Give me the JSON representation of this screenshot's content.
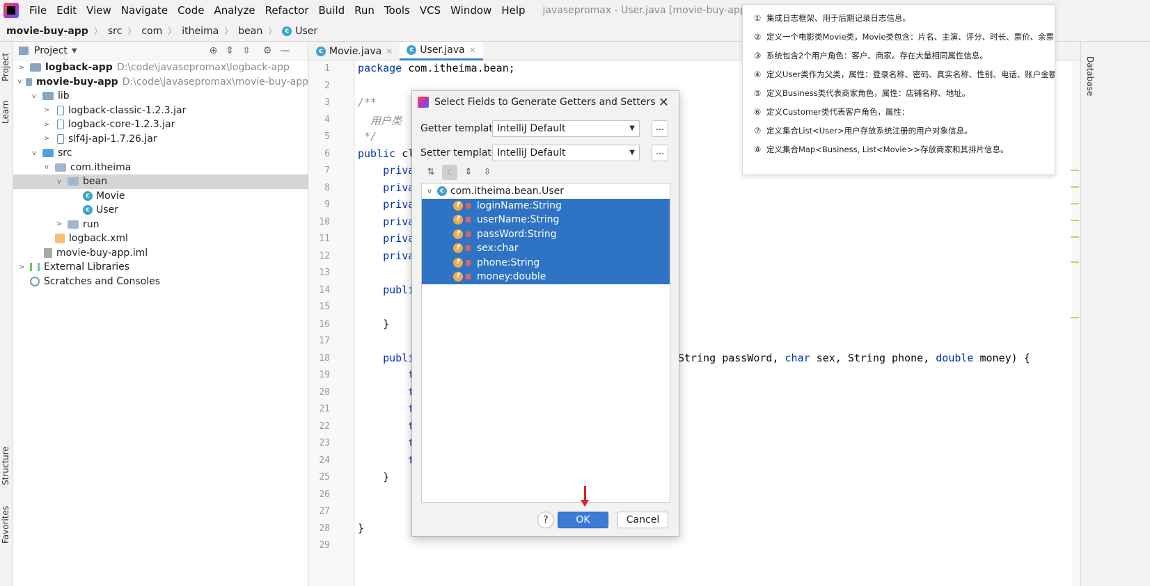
{
  "menubar": {
    "items": [
      "File",
      "Edit",
      "View",
      "Navigate",
      "Code",
      "Analyze",
      "Refactor",
      "Build",
      "Run",
      "Tools",
      "VCS",
      "Window",
      "Help"
    ],
    "window_title": "javasepromax - User.java [movie-buy-app]"
  },
  "navbar": {
    "crumbs": [
      "movie-buy-app",
      "src",
      "com",
      "itheima",
      "bean",
      "User"
    ]
  },
  "left_strip": {
    "project": "Project",
    "learn": "Learn",
    "structure": "Structure",
    "favorites": "Favorites"
  },
  "right_strip": {
    "database": "Database"
  },
  "project_panel": {
    "title": "Project",
    "tree": [
      {
        "label": "logback-app",
        "path": "D:\\code\\javasepromax\\logback-app",
        "bold": true
      },
      {
        "label": "movie-buy-app",
        "path": "D:\\code\\javasepromax\\movie-buy-app",
        "bold": true
      },
      {
        "label": "lib"
      },
      {
        "label": "logback-classic-1.2.3.jar"
      },
      {
        "label": "logback-core-1.2.3.jar"
      },
      {
        "label": "slf4j-api-1.7.26.jar"
      },
      {
        "label": "src"
      },
      {
        "label": "com.itheima"
      },
      {
        "label": "bean"
      },
      {
        "label": "Movie"
      },
      {
        "label": "User"
      },
      {
        "label": "run"
      },
      {
        "label": "logback.xml"
      },
      {
        "label": "movie-buy-app.iml"
      },
      {
        "label": "External Libraries"
      },
      {
        "label": "Scratches and Consoles"
      }
    ]
  },
  "editor": {
    "tabs": [
      "Movie.java",
      "User.java"
    ],
    "line_numbers": [
      "1",
      "2",
      "3",
      "4",
      "5",
      "6",
      "7",
      "8",
      "9",
      "10",
      "11",
      "12",
      "13",
      "14",
      "15",
      "16",
      "17",
      "18",
      "19",
      "20",
      "21",
      "22",
      "23",
      "24",
      "25",
      "26",
      "27",
      "28",
      "29"
    ],
    "code": {
      "l1_kw": "package",
      "l1_rest": " com.itheima.bean;",
      "l3": "/**",
      "l4": "  用户类",
      "l5": " */",
      "l6_kw": "public",
      "l6_rest": " cl",
      "l7": "    priva",
      "l8": "    priva",
      "l9": "    priva",
      "l10": "    priva",
      "l11": "    priva",
      "l12": "    priva",
      "l14": "    publi",
      "l16": "    }",
      "l18": "    publi",
      "l18_tail_a": "String passWord, ",
      "l18_tail_kw1": "char",
      "l18_tail_b": " sex, String phone, ",
      "l18_tail_kw2": "double",
      "l18_tail_c": " money) {",
      "l19": "        t",
      "l20": "        t",
      "l21": "        t",
      "l22": "        t",
      "l23": "        t",
      "l24": "        t",
      "l25": "    }",
      "l28": "}"
    }
  },
  "notes": [
    {
      "num": "①",
      "text": "集成日志框架、用于后期记录日志信息。"
    },
    {
      "num": "②",
      "text": "定义一个电影类Movie类，Movie类包含：片名、主演、评分、时长、票价、余票"
    },
    {
      "num": "③",
      "text": "系统包含2个用户角色：客户、商家。存在大量相同属性信息。"
    },
    {
      "num": "④",
      "text": "定义User类作为父类，属性：登录名称、密码、真实名称、性别、电话、账户金额"
    },
    {
      "num": "⑤",
      "text": "定义Business类代表商家角色，属性：店铺名称、地址。"
    },
    {
      "num": "⑥",
      "text": "定义Customer类代表客户角色，属性："
    },
    {
      "num": "⑦",
      "text": "定义集合List<User>用户存放系统注册的用户对象信息。"
    },
    {
      "num": "⑧",
      "text": "定义集合Map<Business, List<Movie>>存放商家和其排片信息。"
    }
  ],
  "dialog": {
    "title": "Select Fields to Generate Getters and Setters",
    "getter_label": "Getter template:",
    "getter_value": "IntelliJ Default",
    "setter_label": "Setter template:",
    "setter_value": "IntelliJ Default",
    "dots": "...",
    "class_name": "com.itheima.bean.User",
    "fields": [
      "loginName:String",
      "userName:String",
      "passWord:String",
      "sex:char",
      "phone:String",
      "money:double"
    ],
    "ok": "OK",
    "cancel": "Cancel",
    "help": "?"
  }
}
